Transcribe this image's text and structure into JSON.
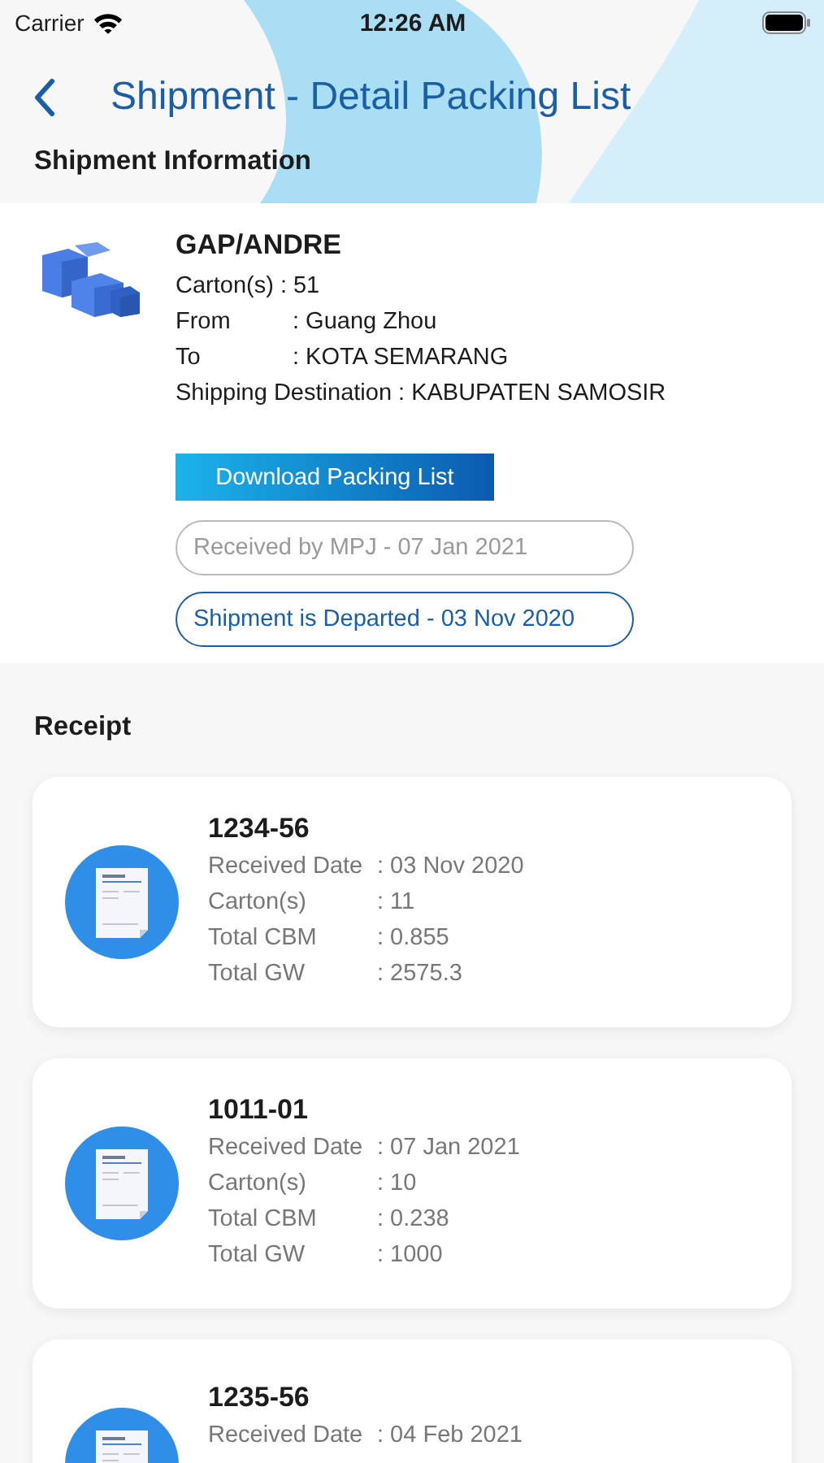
{
  "status_bar": {
    "carrier": "Carrier",
    "time": "12:26 AM"
  },
  "header": {
    "title": "Shipment - Detail Packing List"
  },
  "shipment": {
    "section_title": "Shipment Information",
    "name": "GAP/ANDRE",
    "fields": [
      {
        "label": "Carton(s)",
        "value": ": 51",
        "wide": false
      },
      {
        "label": "From",
        "value": ": Guang Zhou",
        "wide": true
      },
      {
        "label": "To",
        "value": ": KOTA SEMARANG",
        "wide": true
      },
      {
        "label": "Shipping Destination",
        "value": ": KABUPATEN SAMOSIR",
        "wide": false
      }
    ],
    "download_button": "Download Packing List",
    "statuses": [
      {
        "text": "Received by MPJ - 07 Jan 2021",
        "active": false
      },
      {
        "text": "Shipment is Departed - 03 Nov 2020",
        "active": true
      }
    ]
  },
  "receipt": {
    "section_title": "Receipt",
    "items": [
      {
        "number": "1234-56",
        "fields": [
          {
            "label": "Received Date",
            "value": ": 03 Nov 2020"
          },
          {
            "label": "Carton(s)",
            "value": ": 11"
          },
          {
            "label": "Total CBM",
            "value": ": 0.855"
          },
          {
            "label": "Total GW",
            "value": ": 2575.3"
          }
        ]
      },
      {
        "number": "1011-01",
        "fields": [
          {
            "label": "Received Date",
            "value": ": 07 Jan 2021"
          },
          {
            "label": "Carton(s)",
            "value": ": 10"
          },
          {
            "label": "Total CBM",
            "value": ": 0.238"
          },
          {
            "label": "Total GW",
            "value": ": 1000"
          }
        ]
      },
      {
        "number": "1235-56",
        "fields": [
          {
            "label": "Received Date",
            "value": ": 04 Feb 2021"
          }
        ]
      }
    ]
  }
}
